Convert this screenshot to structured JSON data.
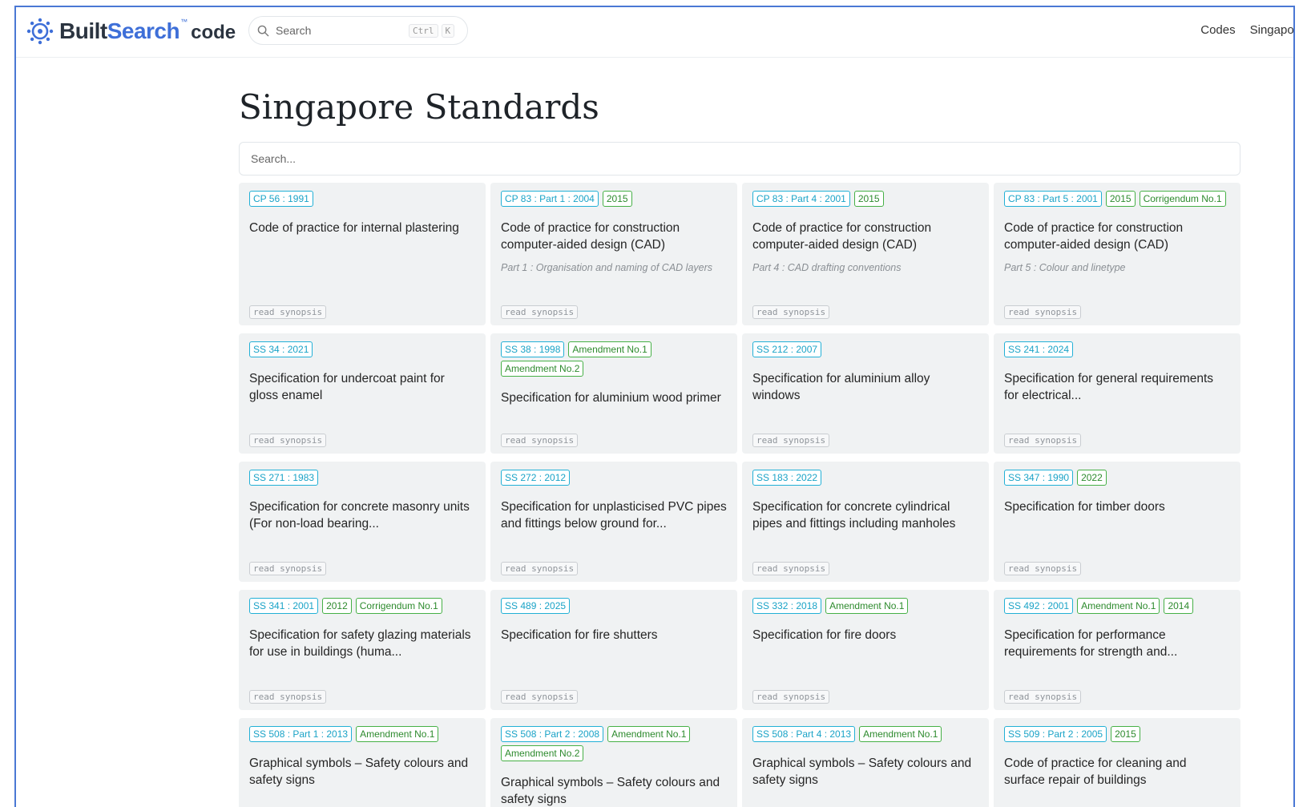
{
  "brand": {
    "part1": "Built",
    "part2": "Search",
    "tm": "™",
    "part3": "code"
  },
  "top_search": {
    "placeholder": "Search",
    "shortcut_ctrl": "Ctrl",
    "shortcut_key": "K"
  },
  "nav": {
    "items": [
      "Codes",
      "Singapore"
    ]
  },
  "page": {
    "title": "Singapore Standards",
    "search_placeholder": "Search..."
  },
  "synopsis_label": "read synopsis",
  "cards": [
    {
      "tags": [
        {
          "t": "CP 56 : 1991",
          "k": "code"
        }
      ],
      "title": "Code of practice for internal plastering",
      "sub": ""
    },
    {
      "tags": [
        {
          "t": "CP 83 : Part 1 : 2004",
          "k": "code"
        },
        {
          "t": "2015",
          "k": "rev"
        }
      ],
      "title": "Code of practice for construction computer-aided design (CAD)",
      "sub": "Part 1 : Organisation and naming of CAD layers"
    },
    {
      "tags": [
        {
          "t": "CP 83 : Part 4 : 2001",
          "k": "code"
        },
        {
          "t": "2015",
          "k": "rev"
        }
      ],
      "title": "Code of practice for construction computer-aided design (CAD)",
      "sub": "Part 4 : CAD drafting conventions"
    },
    {
      "tags": [
        {
          "t": "CP 83 : Part 5 : 2001",
          "k": "code"
        },
        {
          "t": "2015",
          "k": "rev"
        },
        {
          "t": "Corrigendum No.1",
          "k": "rev"
        }
      ],
      "title": "Code of practice for construction computer-aided design (CAD)",
      "sub": "Part 5 : Colour and linetype"
    },
    {
      "tags": [
        {
          "t": "SS 34 : 2021",
          "k": "code"
        }
      ],
      "title": "Specification for undercoat paint for gloss enamel",
      "sub": ""
    },
    {
      "tags": [
        {
          "t": "SS 38 : 1998",
          "k": "code"
        },
        {
          "t": "Amendment No.1",
          "k": "rev"
        },
        {
          "t": "Amendment No.2",
          "k": "rev"
        }
      ],
      "title": "Specification for aluminium wood primer",
      "sub": ""
    },
    {
      "tags": [
        {
          "t": "SS 212 : 2007",
          "k": "code"
        }
      ],
      "title": "Specification for aluminium alloy windows",
      "sub": ""
    },
    {
      "tags": [
        {
          "t": "SS 241 : 2024",
          "k": "code"
        }
      ],
      "title": "Specification for general requirements for electrical...",
      "sub": ""
    },
    {
      "tags": [
        {
          "t": "SS 271 : 1983",
          "k": "code"
        }
      ],
      "title": "Specification for concrete masonry units (For non-load bearing...",
      "sub": ""
    },
    {
      "tags": [
        {
          "t": "SS 272 : 2012",
          "k": "code"
        }
      ],
      "title": "Specification for unplasticised PVC pipes and fittings below ground for...",
      "sub": ""
    },
    {
      "tags": [
        {
          "t": "SS 183 : 2022",
          "k": "code"
        }
      ],
      "title": "Specification for concrete cylindrical pipes and fittings including manholes",
      "sub": ""
    },
    {
      "tags": [
        {
          "t": "SS 347 : 1990",
          "k": "code"
        },
        {
          "t": "2022",
          "k": "rev"
        }
      ],
      "title": "Specification for timber doors",
      "sub": ""
    },
    {
      "tags": [
        {
          "t": "SS 341 : 2001",
          "k": "code"
        },
        {
          "t": "2012",
          "k": "rev"
        },
        {
          "t": "Corrigendum No.1",
          "k": "rev"
        }
      ],
      "title": "Specification for safety glazing materials for use in buildings (huma...",
      "sub": ""
    },
    {
      "tags": [
        {
          "t": "SS 489 : 2025",
          "k": "code"
        }
      ],
      "title": "Specification for fire shutters",
      "sub": ""
    },
    {
      "tags": [
        {
          "t": "SS 332 : 2018",
          "k": "code"
        },
        {
          "t": "Amendment No.1",
          "k": "rev"
        }
      ],
      "title": "Specification for fire doors",
      "sub": ""
    },
    {
      "tags": [
        {
          "t": "SS 492 : 2001",
          "k": "code"
        },
        {
          "t": "Amendment No.1",
          "k": "rev"
        },
        {
          "t": "2014",
          "k": "rev"
        }
      ],
      "title": "Specification for performance requirements for strength and...",
      "sub": ""
    },
    {
      "tags": [
        {
          "t": "SS 508 : Part 1 : 2013",
          "k": "code"
        },
        {
          "t": "Amendment No.1",
          "k": "rev"
        }
      ],
      "title": "Graphical symbols – Safety colours and safety signs",
      "sub": ""
    },
    {
      "tags": [
        {
          "t": "SS 508 : Part 2 : 2008",
          "k": "code"
        },
        {
          "t": "Amendment No.1",
          "k": "rev"
        },
        {
          "t": "Amendment No.2",
          "k": "rev"
        }
      ],
      "title": "Graphical symbols – Safety colours and safety signs",
      "sub": ""
    },
    {
      "tags": [
        {
          "t": "SS 508 : Part 4 : 2013",
          "k": "code"
        },
        {
          "t": "Amendment No.1",
          "k": "rev"
        }
      ],
      "title": "Graphical symbols – Safety colours and safety signs",
      "sub": ""
    },
    {
      "tags": [
        {
          "t": "SS 509 : Part 2 : 2005",
          "k": "code"
        },
        {
          "t": "2015",
          "k": "rev"
        }
      ],
      "title": "Code of practice for cleaning and surface repair of buildings",
      "sub": ""
    }
  ],
  "colors": {
    "accent": "#3e6fd8",
    "code_tag": "#22b0d6",
    "revision_tag": "#46b046",
    "card_bg": "#f0f2f3"
  },
  "icons": {
    "logo": "gear-logo-icon",
    "search": "search-icon"
  }
}
